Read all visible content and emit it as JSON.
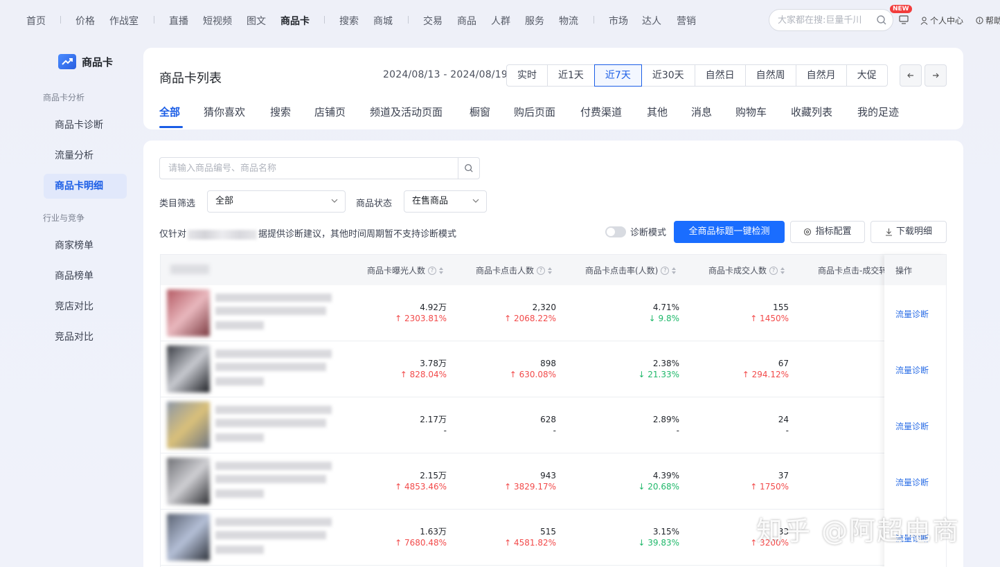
{
  "topnav": {
    "items": [
      "首页",
      "价格",
      "作战室",
      "直播",
      "短视频",
      "图文",
      "商品卡",
      "搜索",
      "商城",
      "交易",
      "商品",
      "人群",
      "服务",
      "物流",
      "市场",
      "达人",
      "营销"
    ],
    "active": "商品卡",
    "search_placeholder": "大家都在搜:巨量千川",
    "new_badge": "NEW",
    "personal_center": "个人中心",
    "help": "帮助"
  },
  "sidebar": {
    "logo_text": "商品卡",
    "group1": "商品卡分析",
    "items1": [
      "商品卡诊断",
      "流量分析",
      "商品卡明细"
    ],
    "group2": "行业与竞争",
    "items2": [
      "商家榜单",
      "商品榜单",
      "竞店对比",
      "竞品对比"
    ],
    "active": "商品卡明细"
  },
  "header": {
    "title": "商品卡列表",
    "date_range": "2024/08/13 - 2024/08/19",
    "periods": [
      "实时",
      "近1天",
      "近7天",
      "近30天",
      "自然日",
      "自然周",
      "自然月",
      "大促"
    ],
    "active_period": "近7天",
    "tabs": [
      "全部",
      "猜你喜欢",
      "搜索",
      "店铺页",
      "频道及活动页面",
      "橱窗",
      "购后页面",
      "付费渠道",
      "其他",
      "消息",
      "购物车",
      "收藏列表",
      "我的足迹"
    ],
    "active_tab": "全部"
  },
  "filters": {
    "search_placeholder": "请输入商品编号、商品名称",
    "category_label": "类目筛选",
    "category_value": "全部",
    "status_label": "商品状态",
    "status_value": "在售商品"
  },
  "toolbar": {
    "notice_prefix": "仅针对",
    "notice_suffix": "据提供诊断建议，其他时间周期暂不支持诊断模式",
    "diagnose_mode": "诊断模式",
    "primary_button": "全商品标题一键检测",
    "metrics_button": "指标配置",
    "download_button": "下载明细"
  },
  "table": {
    "columns": [
      "商品卡曝光人数",
      "商品卡点击人数",
      "商品卡点击率(人数)",
      "商品卡成交人数",
      "商品卡点击-成交转"
    ],
    "op_header": "操作",
    "op_link": "流量诊断",
    "rows": [
      {
        "cells": [
          [
            "4.92万",
            "2303.81%",
            "up"
          ],
          [
            "2,320",
            "2068.22%",
            "up"
          ],
          [
            "4.71%",
            "9.8%",
            "down"
          ],
          [
            "155",
            "1450%",
            "up"
          ]
        ]
      },
      {
        "cells": [
          [
            "3.78万",
            "828.04%",
            "up"
          ],
          [
            "898",
            "630.08%",
            "up"
          ],
          [
            "2.38%",
            "21.33%",
            "down"
          ],
          [
            "67",
            "294.12%",
            "up"
          ]
        ]
      },
      {
        "cells": [
          [
            "2.17万",
            "-",
            "none"
          ],
          [
            "628",
            "-",
            "none"
          ],
          [
            "2.89%",
            "-",
            "none"
          ],
          [
            "24",
            "-",
            "none"
          ]
        ]
      },
      {
        "cells": [
          [
            "2.15万",
            "4853.46%",
            "up"
          ],
          [
            "943",
            "3829.17%",
            "up"
          ],
          [
            "4.39%",
            "20.68%",
            "down"
          ],
          [
            "37",
            "1750%",
            "up"
          ]
        ]
      },
      {
        "cells": [
          [
            "1.63万",
            "7680.48%",
            "up"
          ],
          [
            "515",
            "4581.82%",
            "up"
          ],
          [
            "3.15%",
            "39.83%",
            "down"
          ],
          [
            "33",
            "3200%",
            "up"
          ]
        ]
      }
    ]
  },
  "watermark": "知乎 @阿超电商",
  "colors": {
    "accent": "#1a5de6",
    "primary_btn": "#1a6dff",
    "up": "#f24a4a",
    "down": "#1fb86a"
  }
}
